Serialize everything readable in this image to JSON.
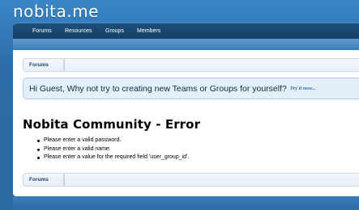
{
  "site": {
    "logo_text": "nobita.me"
  },
  "nav": {
    "items": [
      {
        "label": "Forums"
      },
      {
        "label": "Resources"
      },
      {
        "label": "Groups"
      },
      {
        "label": "Members"
      }
    ]
  },
  "breadcrumb_top": {
    "label": "Forums"
  },
  "notice": {
    "text": "Hi Guest, Why not try to creating new Teams or Groups for yourself?",
    "link": "Try it now..."
  },
  "page": {
    "title": "Nobita Community - Error"
  },
  "errors": [
    "Please enter a valid password.",
    "Please enter a valid name.",
    "Please enter a value for the required field 'user_group_id'."
  ],
  "breadcrumb_bottom": {
    "label": "Forums"
  },
  "colors": {
    "header_bg": "#2d6ea8",
    "navbar_bg": "#1d4f7c",
    "notice_bg": "#e3eff9",
    "link": "#2f6aa2"
  }
}
